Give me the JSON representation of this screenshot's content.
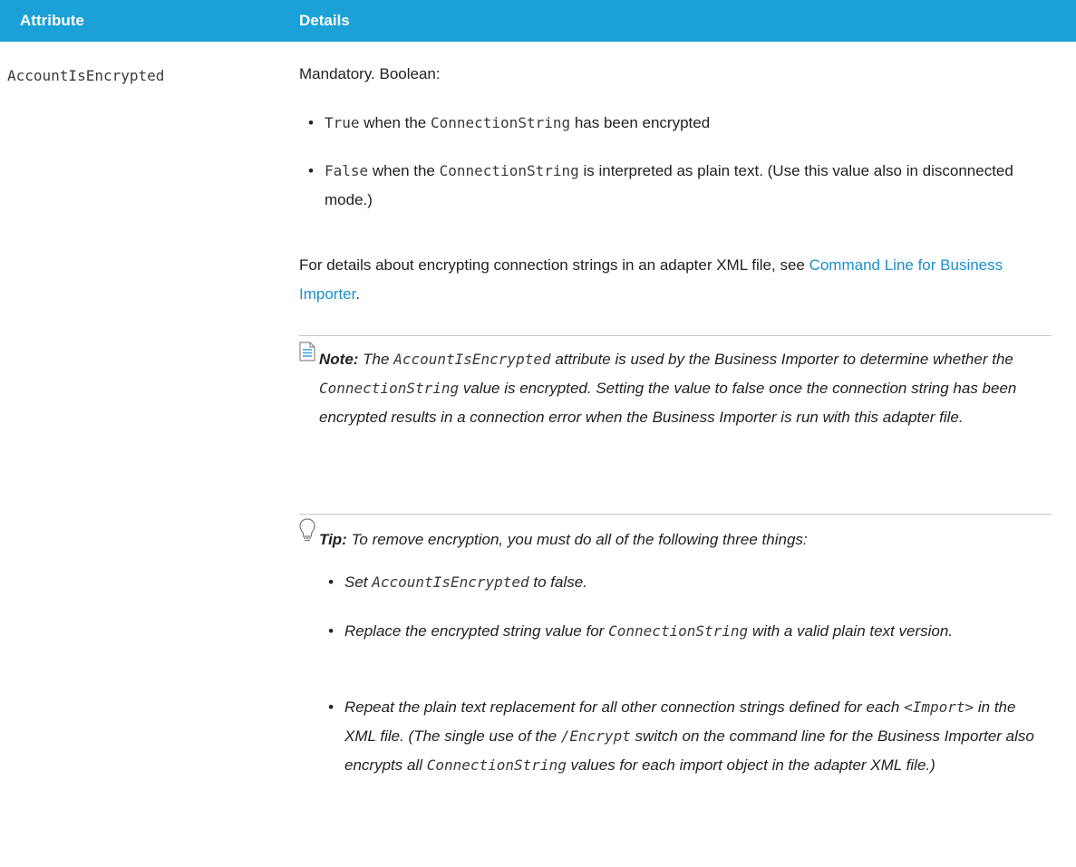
{
  "header": {
    "col1": "Attribute",
    "col2": "Details"
  },
  "row": {
    "attribute": "AccountIsEncrypted",
    "mandatory": "Mandatory. Boolean:",
    "bullet1": {
      "code": "True",
      "text": " when the ",
      "code2": "ConnectionString",
      "text2": " has been encrypted"
    },
    "bullet2": {
      "code": "False",
      "text": " when the ",
      "code2": "ConnectionString",
      "text2": " is interpreted as plain text. (Use this value also in disconnected mode.)"
    },
    "details_text": "For details about encrypting connection strings in an adapter XML file, see ",
    "details_link": "Command Line for Business Importer",
    "details_end": ".",
    "note": {
      "label": "Note:",
      "t1": " The ",
      "c1": "AccountIsEncrypted",
      "t2": " attribute is used by the Business Importer to determine whether the ",
      "c2": "ConnectionString",
      "t3": " value is encrypted. Setting the value to false once the connection string has been encrypted results in a connection error when the Business Importer is run with this adapter file."
    },
    "tip": {
      "label": "Tip:",
      "intro": " To remove encryption, you must do all of the following three things:",
      "b1": {
        "t1": "Set ",
        "c1": "AccountIsEncrypted",
        "t2": " to false."
      },
      "b2": {
        "t1": "Replace the encrypted string value for ",
        "c1": "ConnectionString",
        "t2": " with a valid plain text version."
      },
      "b3": {
        "t1": "Repeat the plain text replacement for all other connection strings defined for each ",
        "c1": "<Import>",
        "t2": " in the XML file. (The single use of the ",
        "c2": "/Encrypt",
        "t3": " switch on the command line for the Business Importer also encrypts all ",
        "c3": "ConnectionString",
        "t4": " values for each import object in the adapter XML file.)"
      }
    }
  }
}
